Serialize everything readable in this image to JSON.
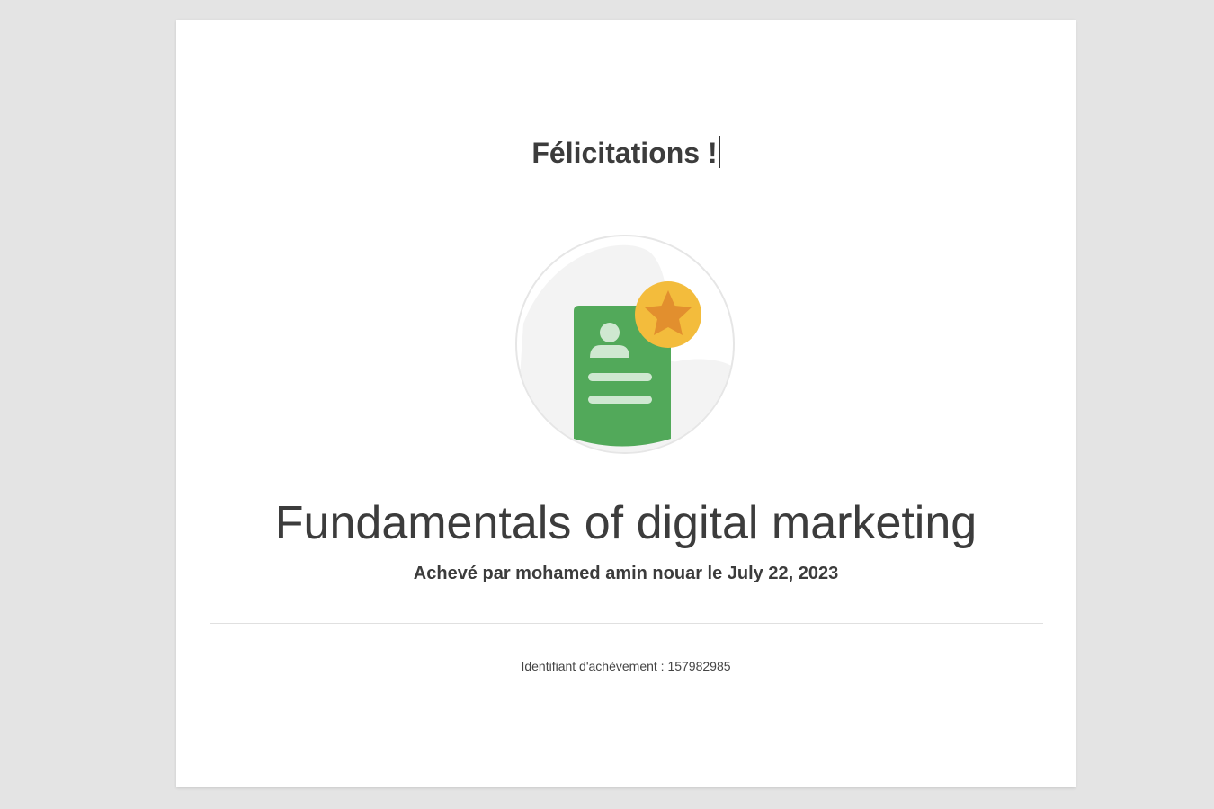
{
  "certificate": {
    "heading": "Félicitations !",
    "course_title": "Fundamentals of digital marketing",
    "completed_by": "Achevé par mohamed amin nouar le July 22, 2023",
    "achievement_id": "Identifiant d'achèvement : 157982985"
  },
  "badge": {
    "icon": "certificate-badge-icon",
    "card_color": "#52a95a",
    "medal_color": "#f3bc3c",
    "star_color": "#e28f2e"
  },
  "colors": {
    "background": "#e4e4e4",
    "page": "#ffffff",
    "text": "#3c3c3c"
  }
}
